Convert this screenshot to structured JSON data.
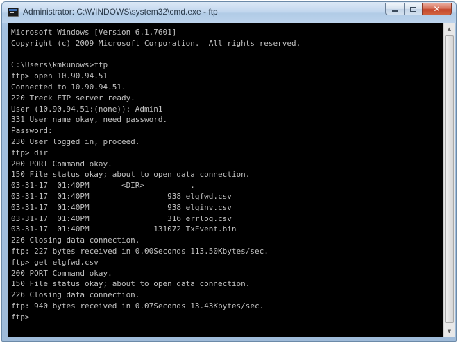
{
  "window": {
    "title": "Administrator: C:\\WINDOWS\\system32\\cmd.exe - ftp",
    "icon": "console-icon",
    "controls": {
      "minimize": "minimize-icon",
      "maximize": "maximize-icon",
      "close": "close-icon"
    },
    "close_glyph": "✕"
  },
  "console": {
    "lines": [
      "Microsoft Windows [Version 6.1.7601]",
      "Copyright (c) 2009 Microsoft Corporation.  All rights reserved.",
      "",
      "C:\\Users\\kmkunows>ftp",
      "ftp> open 10.90.94.51",
      "Connected to 10.90.94.51.",
      "220 Treck FTP server ready.",
      "User (10.90.94.51:(none)): Admin1",
      "331 User name okay, need password.",
      "Password:",
      "230 User logged in, proceed.",
      "ftp> dir",
      "200 PORT Command okay.",
      "150 File status okay; about to open data connection.",
      "03-31-17  01:40PM       <DIR>          .",
      "03-31-17  01:40PM                 938 elgfwd.csv",
      "03-31-17  01:40PM                 938 elginv.csv",
      "03-31-17  01:40PM                 316 errlog.csv",
      "03-31-17  01:40PM              131072 TxEvent.bin",
      "226 Closing data connection.",
      "ftp: 227 bytes received in 0.00Seconds 113.50Kbytes/sec.",
      "ftp> get elgfwd.csv",
      "200 PORT Command okay.",
      "150 File status okay; about to open data connection.",
      "226 Closing data connection.",
      "ftp: 940 bytes received in 0.07Seconds 13.43Kbytes/sec.",
      "ftp>"
    ]
  },
  "scrollbar": {
    "up_icon": "▲",
    "down_icon": "▼"
  }
}
